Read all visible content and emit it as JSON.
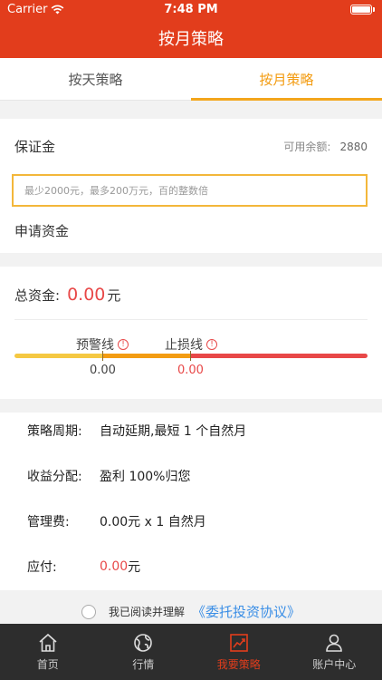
{
  "status": {
    "carrier": "Carrier",
    "time": "7:48 PM"
  },
  "nav": {
    "title": "按月策略"
  },
  "tabs": [
    {
      "label": "按天策略",
      "active": false
    },
    {
      "label": "按月策略",
      "active": true
    }
  ],
  "deposit": {
    "label": "保证金",
    "balance_label": "可用余额:",
    "balance_value": "2880",
    "input_value": "",
    "input_placeholder": "最少2000元，最多200万元，百的整数倍",
    "apply_label": "申请资金"
  },
  "total": {
    "label": "总资金:",
    "value": "0.00",
    "unit": "元",
    "warning_label": "预警线",
    "warning_value": "0.00",
    "stoploss_label": "止损线",
    "stoploss_value": "0.00",
    "info_glyph": "!",
    "colors": {
      "yellow": "#f5c842",
      "orange": "#f39c12",
      "red": "#e84848"
    }
  },
  "summary": {
    "period_label": "策略周期:",
    "period_value": "自动延期,最短 1 个自然月",
    "profit_label": "收益分配:",
    "profit_value": "盈利 100%归您",
    "fee_label": "管理费:",
    "fee_value": "0.00元 x 1 自然月",
    "pay_label": "应付:",
    "pay_value": "0.00",
    "pay_unit": "元"
  },
  "agreement": {
    "checked": false,
    "text": "我已阅读并理解",
    "link": "《委托投资协议》"
  },
  "bottom_tabs": [
    {
      "label": "首页",
      "icon": "home-icon",
      "active": false
    },
    {
      "label": "行情",
      "icon": "globe-icon",
      "active": false
    },
    {
      "label": "我要策略",
      "icon": "trend-chart-icon",
      "active": true
    },
    {
      "label": "账户中心",
      "icon": "user-icon",
      "active": false
    }
  ],
  "colors": {
    "brand": "#e23d1c",
    "accent": "#f39c12",
    "link": "#3a8ee6",
    "tabbar": "#2d2d2d"
  }
}
